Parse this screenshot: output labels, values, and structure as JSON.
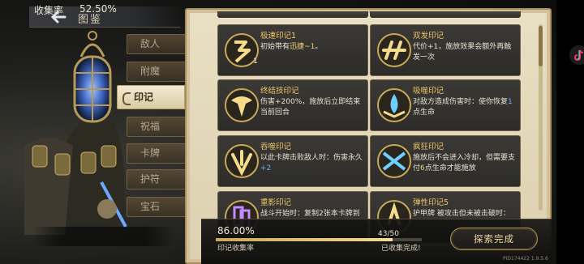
{
  "header": {
    "title": "图鉴"
  },
  "tabs": [
    {
      "label": "敌人",
      "active": false
    },
    {
      "label": "附魔",
      "active": false
    },
    {
      "label": "印记",
      "active": true
    },
    {
      "label": "祝福",
      "active": false
    },
    {
      "label": "卡牌",
      "active": false
    },
    {
      "label": "护符",
      "active": false
    },
    {
      "label": "宝石",
      "active": false
    }
  ],
  "collection": {
    "label": "收集率",
    "value": "52.50%"
  },
  "cards": [
    {
      "name": "极速印记1",
      "desc_a": "初始带有",
      "desc_b": "迅捷",
      "desc_c": "~1",
      "desc_d": "。",
      "badge": "1",
      "icon": "swift-mark-icon"
    },
    {
      "name": "双发印记",
      "desc": "代价+1，施放效果会额外再触发一次",
      "icon": "double-cast-mark-icon"
    },
    {
      "name": "终结技印记",
      "desc": "伤害+200%，施放后立即结束当前回合",
      "icon": "finisher-mark-icon"
    },
    {
      "name": "吸噬印记",
      "desc_a": "对敌方造成伤害时：使你恢复",
      "desc_b": "1",
      "desc_c": "点生命",
      "icon": "absorb-mark-icon"
    },
    {
      "name": "吞噬印记",
      "desc_a": "以此卡牌击败敌人时：伤害永久",
      "desc_b": "+2",
      "icon": "devour-mark-icon"
    },
    {
      "name": "疯狂印记",
      "desc_a": "施放后不会进入冷却，但需要支付",
      "desc_b": "6",
      "desc_c": "点生命才能施放",
      "icon": "madness-mark-icon"
    },
    {
      "name": "重影印记",
      "desc": "战斗开始时：复制2张本卡牌到",
      "icon": "ghost-mark-icon"
    },
    {
      "name": "弹性印记5",
      "desc": "护甲牌 被攻击但未被击破时：",
      "icon": "elastic-mark-icon"
    }
  ],
  "progress": {
    "percent": "86.00%",
    "fraction": "43/50",
    "value": 0.86,
    "label": "印记收集率",
    "done_label": "已收集完成!"
  },
  "explore_button": "探索完成",
  "version": "PID174422 1.9.5.6",
  "colors": {
    "accent_gold": "#f0c46a",
    "parchment": "#e9dfc3",
    "card_bg": "#2d2c29"
  }
}
